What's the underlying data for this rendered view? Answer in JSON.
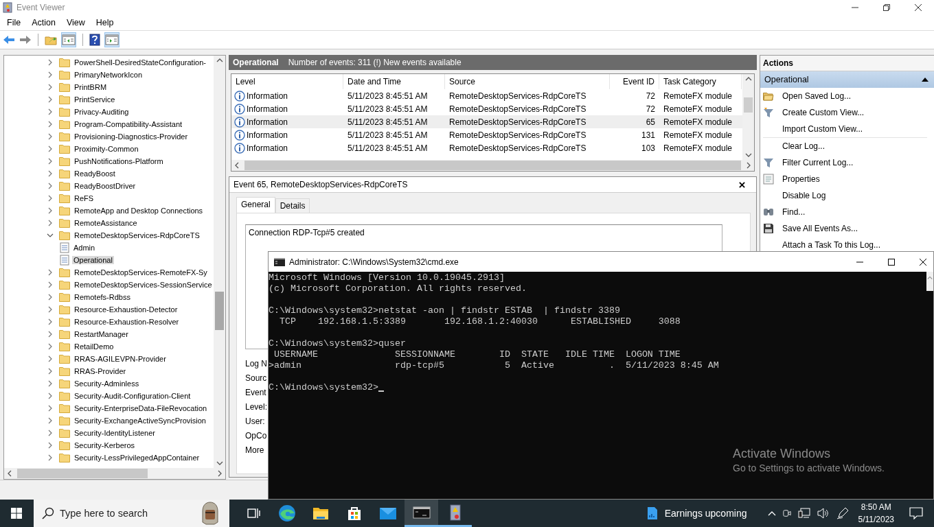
{
  "window": {
    "title": "Event Viewer"
  },
  "menu": [
    "File",
    "Action",
    "View",
    "Help"
  ],
  "tree": [
    {
      "label": "PowerShell-DesiredStateConfiguration-",
      "expanded": false,
      "selected": false
    },
    {
      "label": "PrimaryNetworkIcon",
      "expanded": false,
      "selected": false
    },
    {
      "label": "PrintBRM",
      "expanded": false,
      "selected": false
    },
    {
      "label": "PrintService",
      "expanded": false,
      "selected": false
    },
    {
      "label": "Privacy-Auditing",
      "expanded": false,
      "selected": false
    },
    {
      "label": "Program-Compatibility-Assistant",
      "expanded": false,
      "selected": false
    },
    {
      "label": "Provisioning-Diagnostics-Provider",
      "expanded": false,
      "selected": false
    },
    {
      "label": "Proximity-Common",
      "expanded": false,
      "selected": false
    },
    {
      "label": "PushNotifications-Platform",
      "expanded": false,
      "selected": false
    },
    {
      "label": "ReadyBoost",
      "expanded": false,
      "selected": false
    },
    {
      "label": "ReadyBoostDriver",
      "expanded": false,
      "selected": false
    },
    {
      "label": "ReFS",
      "expanded": false,
      "selected": false
    },
    {
      "label": "RemoteApp and Desktop Connections",
      "expanded": false,
      "selected": false
    },
    {
      "label": "RemoteAssistance",
      "expanded": false,
      "selected": false
    },
    {
      "label": "RemoteDesktopServices-RdpCoreTS",
      "expanded": true,
      "selected": false,
      "children": [
        {
          "label": "Admin",
          "kind": "log",
          "selected": false
        },
        {
          "label": "Operational",
          "kind": "log",
          "selected": true
        }
      ]
    },
    {
      "label": "RemoteDesktopServices-RemoteFX-Sy",
      "expanded": false,
      "selected": false
    },
    {
      "label": "RemoteDesktopServices-SessionService",
      "expanded": false,
      "selected": false
    },
    {
      "label": "Remotefs-Rdbss",
      "expanded": false,
      "selected": false
    },
    {
      "label": "Resource-Exhaustion-Detector",
      "expanded": false,
      "selected": false
    },
    {
      "label": "Resource-Exhaustion-Resolver",
      "expanded": false,
      "selected": false
    },
    {
      "label": "RestartManager",
      "expanded": false,
      "selected": false
    },
    {
      "label": "RetailDemo",
      "expanded": false,
      "selected": false
    },
    {
      "label": "RRAS-AGILEVPN-Provider",
      "expanded": false,
      "selected": false
    },
    {
      "label": "RRAS-Provider",
      "expanded": false,
      "selected": false
    },
    {
      "label": "Security-Adminless",
      "expanded": false,
      "selected": false
    },
    {
      "label": "Security-Audit-Configuration-Client",
      "expanded": false,
      "selected": false
    },
    {
      "label": "Security-EnterpriseData-FileRevocation",
      "expanded": false,
      "selected": false
    },
    {
      "label": "Security-ExchangeActiveSyncProvision",
      "expanded": false,
      "selected": false
    },
    {
      "label": "Security-IdentityListener",
      "expanded": false,
      "selected": false
    },
    {
      "label": "Security-Kerberos",
      "expanded": false,
      "selected": false
    },
    {
      "label": "Security-LessPrivilegedAppContainer",
      "expanded": false,
      "selected": false
    }
  ],
  "log_header": {
    "title": "Operational",
    "info": "Number of events: 311 (!) New events available"
  },
  "events": {
    "columns": [
      "Level",
      "Date and Time",
      "Source",
      "Event ID",
      "Task Category"
    ],
    "rows": [
      {
        "level": "Information",
        "date": "5/11/2023 8:45:51 AM",
        "source": "RemoteDesktopServices-RdpCoreTS",
        "event_id": "72",
        "task_category": "RemoteFX module",
        "selected": false
      },
      {
        "level": "Information",
        "date": "5/11/2023 8:45:51 AM",
        "source": "RemoteDesktopServices-RdpCoreTS",
        "event_id": "72",
        "task_category": "RemoteFX module",
        "selected": false
      },
      {
        "level": "Information",
        "date": "5/11/2023 8:45:51 AM",
        "source": "RemoteDesktopServices-RdpCoreTS",
        "event_id": "65",
        "task_category": "RemoteFX module",
        "selected": true
      },
      {
        "level": "Information",
        "date": "5/11/2023 8:45:51 AM",
        "source": "RemoteDesktopServices-RdpCoreTS",
        "event_id": "131",
        "task_category": "RemoteFX module",
        "selected": false
      },
      {
        "level": "Information",
        "date": "5/11/2023 8:45:51 AM",
        "source": "RemoteDesktopServices-RdpCoreTS",
        "event_id": "103",
        "task_category": "RemoteFX module",
        "selected": false
      }
    ]
  },
  "detail": {
    "title": "Event 65, RemoteDesktopServices-RdpCoreTS",
    "tabs": [
      {
        "label": "General",
        "selected": true
      },
      {
        "label": "Details",
        "selected": false
      }
    ],
    "description": "Connection RDP-Tcp#5 created",
    "fields": [
      "Log N",
      "Sourc",
      "Event",
      "Level:",
      "User:",
      "OpCo",
      "More"
    ]
  },
  "actions": {
    "title": "Actions",
    "section": {
      "title": "Operational",
      "expanded": true
    },
    "items": [
      {
        "label": "Open Saved Log...",
        "kind": "folder",
        "divider_before": false
      },
      {
        "label": "Create Custom View...",
        "kind": "filter-star",
        "divider_before": false
      },
      {
        "label": "Import Custom View...",
        "kind": "none",
        "divider_before": false
      },
      {
        "label": "Clear Log...",
        "kind": "none",
        "divider_before": true
      },
      {
        "label": "Filter Current Log...",
        "kind": "filter",
        "divider_before": false
      },
      {
        "label": "Properties",
        "kind": "properties",
        "divider_before": false
      },
      {
        "label": "Disable Log",
        "kind": "none",
        "divider_before": false
      },
      {
        "label": "Find...",
        "kind": "binoculars",
        "divider_before": false
      },
      {
        "label": "Save All Events As...",
        "kind": "disk",
        "divider_before": false
      },
      {
        "label": "Attach a Task To this Log...",
        "kind": "none",
        "divider_before": false
      }
    ]
  },
  "console": {
    "title": "Administrator: C:\\Windows\\System32\\cmd.exe",
    "blocks": [
      [
        "Microsoft Windows [Version 10.0.19045.2913]",
        "(c) Microsoft Corporation. All rights reserved."
      ],
      [
        "C:\\Windows\\system32>netstat -aon | findstr ESTAB  | findstr 3389",
        "  TCP    192.168.1.5:3389       192.168.1.2:40030      ESTABLISHED     3088"
      ],
      [
        "C:\\Windows\\system32>quser",
        " USERNAME              SESSIONNAME        ID  STATE   IDLE TIME  LOGON TIME",
        ">admin                 rdp-tcp#5           5  Active          .  5/11/2023 8:45 AM"
      ],
      [
        "C:\\Windows\\system32>"
      ]
    ]
  },
  "activation": {
    "title": "Activate Windows",
    "subtitle": "Go to Settings to activate Windows."
  },
  "taskbar": {
    "search": {
      "placeholder": "Type here to search"
    },
    "apps": [
      {
        "kind": "task-view",
        "running": false,
        "active": false
      },
      {
        "kind": "browser",
        "running": false,
        "active": false
      },
      {
        "kind": "explorer",
        "running": false,
        "active": false
      },
      {
        "kind": "store",
        "running": false,
        "active": false
      },
      {
        "kind": "mail",
        "running": false,
        "active": false
      },
      {
        "kind": "console",
        "running": true,
        "active": true
      },
      {
        "kind": "event-viewer",
        "running": true,
        "active": false
      }
    ],
    "news": "Earnings upcoming",
    "time": "8:50 AM",
    "date": "5/11/2023"
  }
}
